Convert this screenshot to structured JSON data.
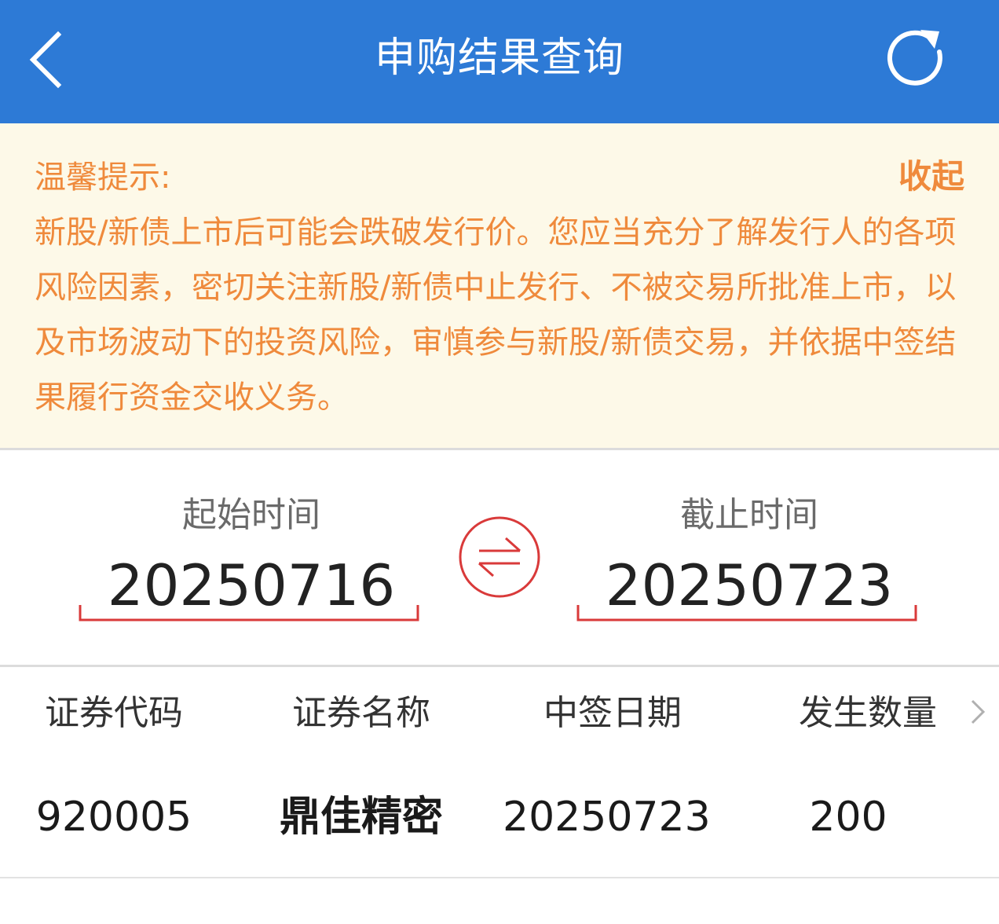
{
  "header": {
    "title": "申购结果查询",
    "back_icon": "chevron-left-icon",
    "refresh_icon": "refresh-icon",
    "background_color": "#2d7ad6"
  },
  "notice": {
    "title": "温馨提示:",
    "collapse_label": "收起",
    "body": "新股/新债上市后可能会跌破发行价。您应当充分了解发行人的各项风险因素，密切关注新股/新债中止发行、不被交易所批准上市，以及市场波动下的投资风险，审慎参与新股/新债交易，并依据中签结果履行资金交收义务。",
    "text_color": "#ef8a3c",
    "background_color": "#fdf9e8"
  },
  "date_range": {
    "start_label": "起始时间",
    "start_value": "20250716",
    "end_label": "截止时间",
    "end_value": "20250723",
    "swap_icon": "swap-arrows-icon",
    "accent_color": "#d93a3a"
  },
  "table": {
    "columns": [
      "证券代码",
      "证券名称",
      "中签日期",
      "发生数量"
    ],
    "more_icon": "chevron-right-icon",
    "rows": [
      {
        "code": "920005",
        "name": "鼎佳精密",
        "date": "20250723",
        "quantity": "200"
      }
    ]
  }
}
